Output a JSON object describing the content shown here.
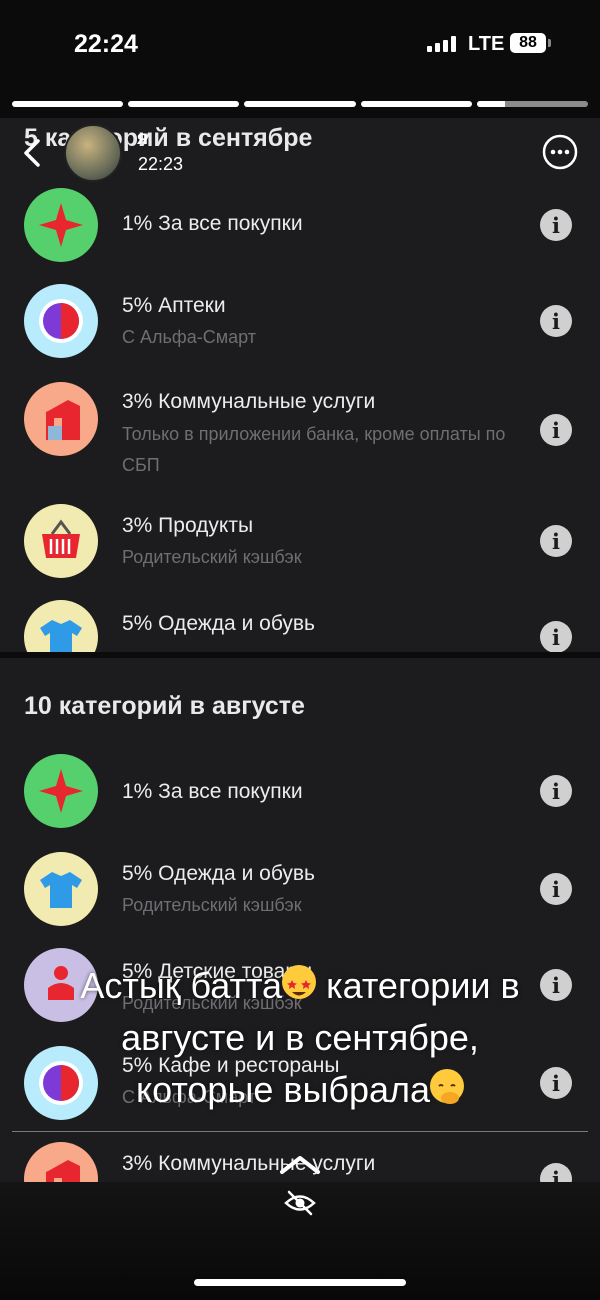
{
  "status_bar": {
    "time": "22:24",
    "network": "LTE",
    "battery": "88"
  },
  "story": {
    "segments": [
      1,
      1,
      1,
      1,
      0.25
    ],
    "user_name": "я",
    "post_time": "22:23"
  },
  "september": {
    "title": "5 категорий в сентябре",
    "items": [
      {
        "title": "1% За все покупки",
        "subtitle": "",
        "icon": "star-icon"
      },
      {
        "title": "5% Аптеки",
        "subtitle": "С Альфа-Смарт",
        "icon": "pharmacy-icon"
      },
      {
        "title": "3% Коммунальные услуги",
        "subtitle": "Только в приложении банка, кроме оплаты по СБП",
        "icon": "house-icon"
      },
      {
        "title": "3% Продукты",
        "subtitle": "Родительский кэшбэк",
        "icon": "basket-icon"
      },
      {
        "title": "5% Одежда и обувь",
        "subtitle": "",
        "icon": "tshirt-icon"
      }
    ]
  },
  "august": {
    "title": "10 категорий в августе",
    "items": [
      {
        "title": "1% За все покупки",
        "subtitle": "",
        "icon": "star-icon"
      },
      {
        "title": "5% Одежда и обувь",
        "subtitle": "Родительский кэшбэк",
        "icon": "tshirt-icon"
      },
      {
        "title": "5% Детские товары",
        "subtitle": "Родительский кэшбэк",
        "icon": "toy-icon"
      },
      {
        "title": "5% Кафе и рестораны",
        "subtitle": "С Альфа-Смарт",
        "icon": "cafe-icon"
      },
      {
        "title": "3% Коммунальные услуги",
        "subtitle": "",
        "icon": "house-icon"
      }
    ]
  },
  "caption": {
    "line1_a": "Астық батта",
    "line1_b": " категории в",
    "line2": "августе и в сентябре,",
    "line3": "которые выбрала",
    "emoji1": "star-struck-emoji",
    "emoji2": "hand-over-mouth-emoji"
  },
  "info_glyph": "i",
  "colors": {
    "card_bg": "#1c1c1e",
    "green_icon_bg": "#56d06c",
    "red_star": "#e8262f",
    "light_blue_bg": "#b8ebfb",
    "orange_bg": "#f7a98a",
    "yellow_bg": "#f2ebb1",
    "lilac_bg": "#c9bfe5"
  }
}
